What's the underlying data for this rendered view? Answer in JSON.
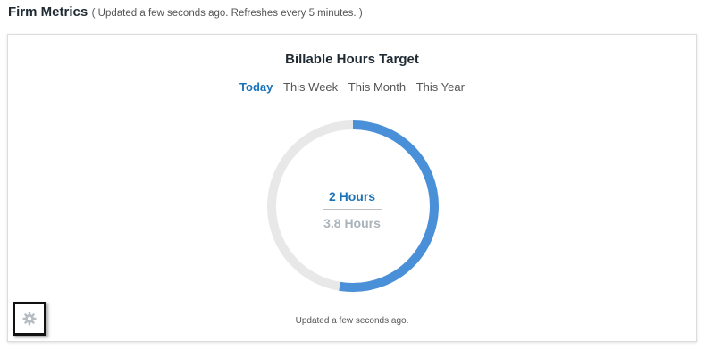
{
  "header": {
    "title": "Firm Metrics",
    "subtitle": "( Updated a few seconds ago. Refreshes every 5 minutes. )"
  },
  "widget": {
    "title": "Billable Hours Target",
    "tabs": [
      {
        "label": "Today",
        "active": true
      },
      {
        "label": "This Week",
        "active": false
      },
      {
        "label": "This Month",
        "active": false
      },
      {
        "label": "This Year",
        "active": false
      }
    ],
    "actual_label": "2 Hours",
    "target_label": "3.8 Hours",
    "progress_fraction": 0.526,
    "updated_text": "Updated a few seconds ago.",
    "settings_icon": "gear-icon"
  },
  "colors": {
    "accent": "#1a73b8",
    "progress_arc": "#4a90d9",
    "track": "#e8e8e8",
    "target_text": "#a9b3ba",
    "gear": "#b5bcc2"
  }
}
